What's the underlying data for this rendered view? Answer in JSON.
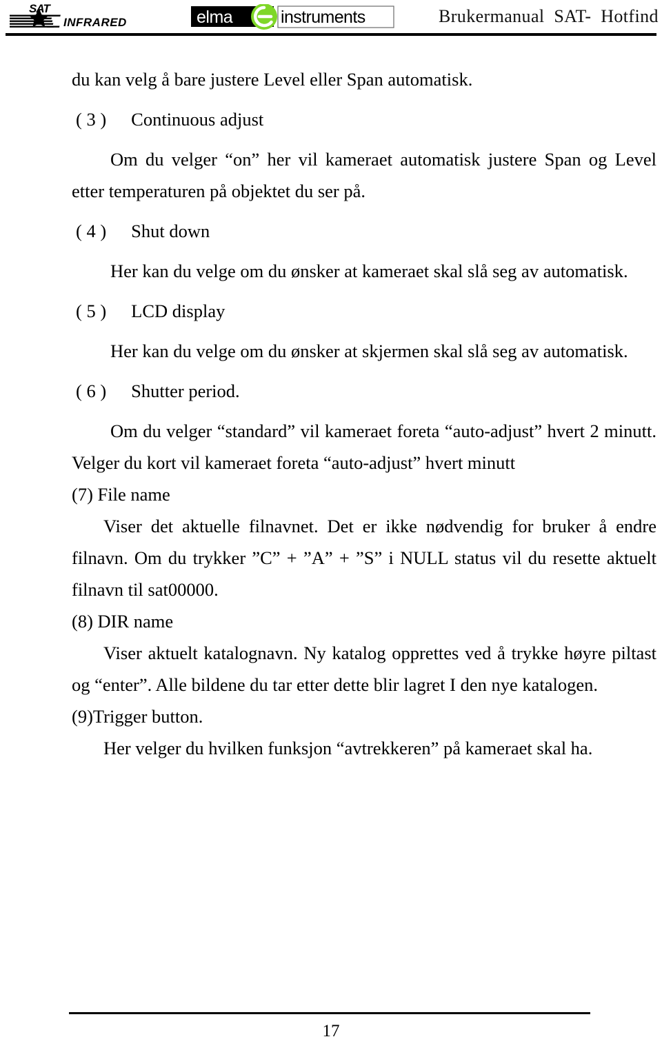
{
  "header": {
    "sat_logo": {
      "icon": "sat-infrared-logo",
      "wordmark_top": "SAT",
      "wordmark_bottom": "INFRARED"
    },
    "elma_logo": {
      "icon": "elma-instruments-logo",
      "word_left": "elma",
      "word_mark": "e",
      "word_right": "instruments",
      "green": "#7FD728"
    },
    "manual_title": "Brukermanual  SAT-  Hotfind"
  },
  "body": {
    "lead_line": "du kan velg å bare justere Level eller Span automatisk.",
    "item3": {
      "number": "( 3 )",
      "title": "Continuous adjust",
      "text": "Om du velger “on” her vil kameraet automatisk justere Span og Level etter temperaturen på objektet du ser på."
    },
    "item4": {
      "number": "( 4 )",
      "title": "Shut down",
      "text": "Her kan du velge om du ønsker at kameraet skal slå seg av automatisk."
    },
    "item5": {
      "number": "( 5 )",
      "title": "LCD display",
      "text": "Her kan du velge om du ønsker at skjermen skal slå seg av automatisk."
    },
    "item6": {
      "number": "( 6 )",
      "title": "Shutter period.",
      "text": "Om du velger “standard” vil kameraet foreta “auto-adjust” hvert 2 minutt. Velger du kort vil kameraet foreta “auto-adjust” hvert minutt"
    },
    "item7": {
      "heading": "(7) File name",
      "text": "Viser det aktuelle filnavnet. Det er ikke nødvendig for bruker å endre filnavn. Om du trykker ”C” + ”A” + ”S” i NULL status vil du resette aktuelt filnavn til sat00000."
    },
    "item8": {
      "heading": "(8) DIR name",
      "text": "Viser aktuelt katalognavn. Ny katalog opprettes ved å trykke høyre piltast og “enter”. Alle bildene du tar etter dette blir lagret I den nye katalogen."
    },
    "item9": {
      "heading": "(9)Trigger button.",
      "text": "Her velger du hvilken funksjon “avtrekkeren” på kameraet skal ha."
    }
  },
  "footer": {
    "page_number": "17"
  }
}
